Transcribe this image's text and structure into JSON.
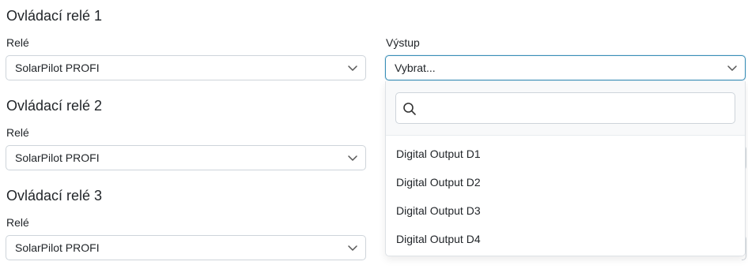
{
  "sections": [
    {
      "title": "Ovládací relé 1",
      "rele_label": "Relé",
      "rele_value": "SolarPilot PROFI",
      "output_label": "Výstup",
      "output_value": "Vybrat..."
    },
    {
      "title": "Ovládací relé 2",
      "rele_label": "Relé",
      "rele_value": "SolarPilot PROFI"
    },
    {
      "title": "Ovládací relé 3",
      "rele_label": "Relé",
      "rele_value": "SolarPilot PROFI"
    }
  ],
  "dropdown": {
    "search_value": "",
    "options": [
      "Digital Output D1",
      "Digital Output D2",
      "Digital Output D3",
      "Digital Output D4"
    ]
  },
  "icons": {
    "chevron": "chevron-down-icon",
    "search": "search-icon"
  },
  "colors": {
    "focus_border": "#3a8fb7",
    "border": "#ced4da",
    "text": "#212529"
  }
}
